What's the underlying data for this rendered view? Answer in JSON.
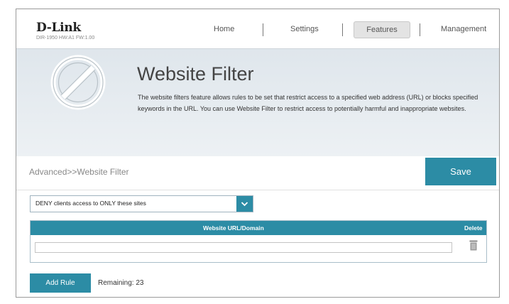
{
  "header": {
    "brand": "D-Link",
    "firmware": "DIR-1950 HW:A1 FW:1.00",
    "nav": [
      "Home",
      "Settings",
      "Features",
      "Management"
    ],
    "active_nav": "Features"
  },
  "banner": {
    "title": "Website Filter",
    "description": "The website filters feature allows rules to be set that restrict access to a specified web address (URL) or blocks specified keywords in the URL. You can use Website Filter to restrict access to potentially harmful and inappropriate websites.",
    "icon": "prohibited-icon"
  },
  "breadcrumb": "Advanced>>Website Filter",
  "save_label": "Save",
  "filter_mode": {
    "selected": "DENY clients access to ONLY these sites"
  },
  "table": {
    "columns": [
      "Website URL/Domain",
      "Delete"
    ],
    "rows": [
      {
        "url": "",
        "delete_icon": "trash-icon"
      }
    ]
  },
  "add_rule_label": "Add Rule",
  "remaining_text": "Remaining: 23",
  "colors": {
    "accent": "#2c8ca5",
    "banner": "#e6ebef"
  }
}
